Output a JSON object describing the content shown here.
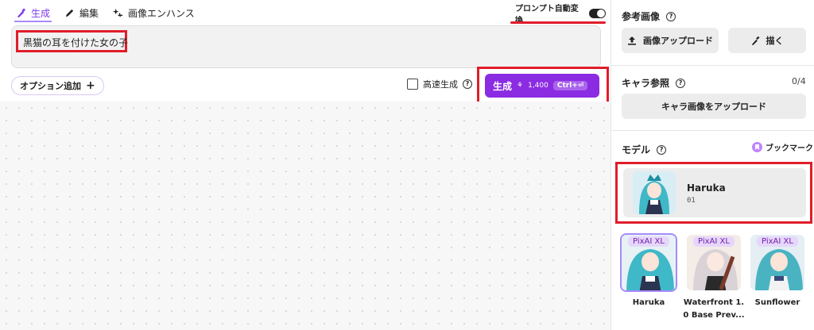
{
  "tabs": [
    {
      "label": "生成",
      "icon": "brush-icon",
      "active": true
    },
    {
      "label": "編集",
      "icon": "pencil-icon",
      "active": false
    },
    {
      "label": "画像エンハンス",
      "icon": "sparkle-icon",
      "active": false
    }
  ],
  "auto_convert": {
    "label": "プロンプト自動変換",
    "enabled": true
  },
  "prompt": {
    "value": "黒猫の耳を付けた女の子"
  },
  "options": {
    "add_label": "オプション追加",
    "add_icon": "plus-icon"
  },
  "fast_gen": {
    "label": "高速生成",
    "checked": false
  },
  "generate": {
    "label": "生成",
    "cost": "1,400",
    "shortcut": "Ctrl+⏎"
  },
  "right": {
    "reference": {
      "title": "参考画像",
      "upload_label": "画像アップロード",
      "draw_label": "描く"
    },
    "character": {
      "title": "キャラ参照",
      "count": "0/4",
      "upload_label": "キャラ画像をアップロード"
    },
    "model": {
      "title": "モデル",
      "bookmark_label": "ブックマーク",
      "selected": {
        "name": "Haruka",
        "version": "01"
      },
      "list": [
        {
          "badge": "PixAI XL",
          "name_lines": [
            "Haruka"
          ],
          "selected": true
        },
        {
          "badge": "PixAI XL",
          "name_lines": [
            "Waterfront 1.",
            "0 Base Prev..."
          ],
          "selected": false
        },
        {
          "badge": "PixAI XL",
          "name_lines": [
            "Sunflower"
          ],
          "selected": false
        }
      ]
    }
  },
  "colors": {
    "accent": "#8b2be2",
    "highlight_red": "#e11d2a",
    "tab_active": "#7c3aed"
  }
}
